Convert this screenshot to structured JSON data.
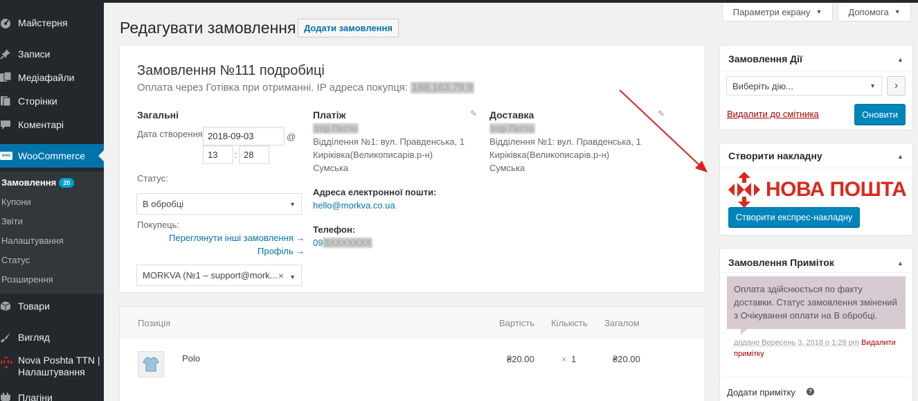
{
  "sidebar": {
    "dashboard": "Майстерня",
    "posts": "Записи",
    "media": "Медіафайли",
    "pages": "Сторінки",
    "comments": "Коментарі",
    "woocommerce": "WooCommerce",
    "woo_icon": "woo",
    "submenu": {
      "orders": "Замовлення",
      "orders_count": "20",
      "coupons": "Купони",
      "reports": "Звіти",
      "settings": "Налаштування",
      "status": "Статус",
      "extensions": "Розширення"
    },
    "products": "Товари",
    "appearance": "Вигляд",
    "np_ttn_line1": "Nova Poshta TTN |",
    "np_ttn_line2": "Налаштування",
    "plugins": "Плагіни"
  },
  "screen_options": "Параметри екрану",
  "help": "Допомога",
  "header": {
    "title": "Редагувати замовлення",
    "add_button": "Додати замовлення"
  },
  "order": {
    "heading": "Замовлення №111 подробиці",
    "subheading": "Оплата через Готівка при отриманні. IP адреса покупця:",
    "ip": "188.163.79.9"
  },
  "general": {
    "title": "Загальні",
    "date_label": "Дата створення:",
    "date_value": "2018-09-03",
    "at": "@",
    "hour": "13",
    "colon": ":",
    "minute": "28",
    "status_label": "Статус:",
    "status_value": "В обробці",
    "customer_label": "Покупець:",
    "view_orders": "Переглянути інші замовлення →",
    "profile": "Профіль →",
    "customer_value": "MORKVA (№1 – support@mork...",
    "clear": "×"
  },
  "billing": {
    "title": "Платіж",
    "name": "Ігор Пєсто",
    "addr1": "Відділення №1: вул. Правденська, 1",
    "addr2": "Киріківка(Великописарів.р-н)",
    "addr3": "Сумська",
    "email_label": "Адреса електронної пошти:",
    "email": "hello@morkva.co.ua",
    "phone_label": "Телефон:",
    "phone_visible": "09",
    "phone_hidden": "8XXXXXXX"
  },
  "shipping": {
    "title": "Доставка",
    "name": "Ігор Пєсто",
    "addr1": "Відділення №1: вул. Правденська, 1",
    "addr2": "Киріківка(Великописарів.р-н)",
    "addr3": "Сумська"
  },
  "items": {
    "col_item": "Позиція",
    "col_cost": "Вартість",
    "col_qty": "Кількість",
    "col_total": "Загалом",
    "rows": [
      {
        "name": "Polo",
        "cost": "₴20.00",
        "qty_x": "×",
        "qty": "1",
        "total": "₴20.00"
      }
    ]
  },
  "actions_box": {
    "title": "Замовлення Дії",
    "select": "Виберіть дію...",
    "go": "›",
    "trash": "Видалити до смітника",
    "update": "Оновити"
  },
  "waybill_box": {
    "title": "Створити накладну",
    "logo_text": "НОВА ПОШТА",
    "button": "Створити експрес-накладну"
  },
  "notes_box": {
    "title": "Замовлення Приміток",
    "note_text": "Оплата здійснюється по факту доставки. Статус замовлення змінений з Очікування оплати на В обробці.",
    "meta": "додано Вересень 3, 2018 о 1:28 pm",
    "delete": "Видалити примітку",
    "add_label": "Додати примітку",
    "help": "?"
  },
  "colors": {
    "sidebar_bg": "#23282d",
    "accent": "#0073aa",
    "button_primary": "#0085ba",
    "np_red": "#da291c",
    "annotation_arrow": "#e0201b"
  }
}
